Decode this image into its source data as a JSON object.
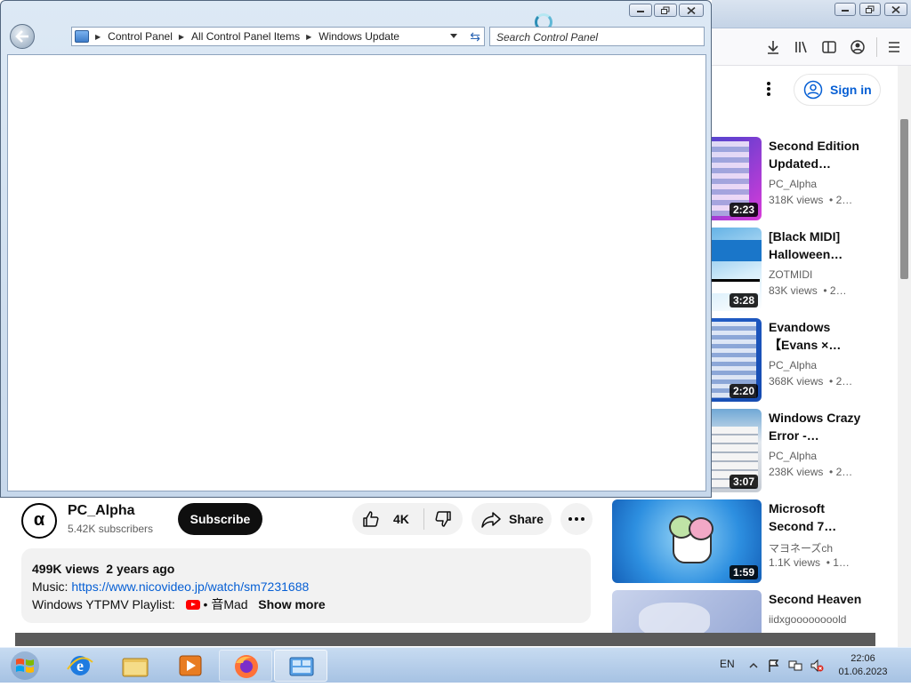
{
  "window": {
    "address_parts": [
      "Control Panel",
      "All Control Panel Items",
      "Windows Update"
    ],
    "search_placeholder": "Search Control Panel"
  },
  "browser": {
    "signin_label": "Sign in"
  },
  "recommendations": [
    {
      "title": "Second Edition Updated…",
      "channel": "PC_Alpha",
      "views": "318K views",
      "age": "• 2…",
      "duration": "2:23"
    },
    {
      "title": "[Black MIDI] Halloween…",
      "channel": "ZOTMIDI",
      "views": "83K views",
      "age": "• 2…",
      "duration": "3:28"
    },
    {
      "title": "Evandows 【Evans ×…",
      "channel": "PC_Alpha",
      "views": "368K views",
      "age": "• 2…",
      "duration": "2:20"
    },
    {
      "title": "Windows Crazy Error -…",
      "channel": "PC_Alpha",
      "views": "238K views",
      "age": "• 2…",
      "duration": "3:07"
    },
    {
      "title": "Microsoft Second 7…",
      "channel": "マヨネーズch",
      "views": "1.1K views",
      "age": "• 1…",
      "duration": "1:59"
    },
    {
      "title": "Second Heaven",
      "channel": "iidxgoooooooold",
      "views": "",
      "age": "",
      "duration": ""
    }
  ],
  "video": {
    "channel_name": "PC_Alpha",
    "avatar_glyph": "α",
    "subscribers": "5.42K subscribers",
    "subscribe_label": "Subscribe",
    "likes": "4K",
    "share_label": "Share",
    "views": "499K views",
    "posted": "2 years ago",
    "music_label": "Music: ",
    "music_link": "https://www.nicovideo.jp/watch/sm7231688",
    "playlist_label": "Windows YTPMV Playlist: ",
    "playlist_tag": " • 音Mad",
    "show_more": "Show more"
  },
  "taskbar": {
    "language": "EN",
    "time": "22:06",
    "date": "01.06.2023"
  },
  "icons": [
    "back-icon",
    "control-panel-icon",
    "refresh-icon",
    "download-icon",
    "library-icon",
    "sidebar-icon",
    "account-icon",
    "menu-icon",
    "kebab-icon",
    "like-icon",
    "dislike-icon",
    "share-icon",
    "more-icon",
    "windows-logo-icon",
    "ie-icon",
    "explorer-icon",
    "media-player-icon",
    "firefox-icon",
    "control-panel-task-icon",
    "busy-icon"
  ],
  "colors": {
    "link": "#065fd4",
    "subscribe_bg": "#0f0f0f",
    "taskbar": "#b3cbe8",
    "win7_chrome": "#c7d8eb"
  }
}
